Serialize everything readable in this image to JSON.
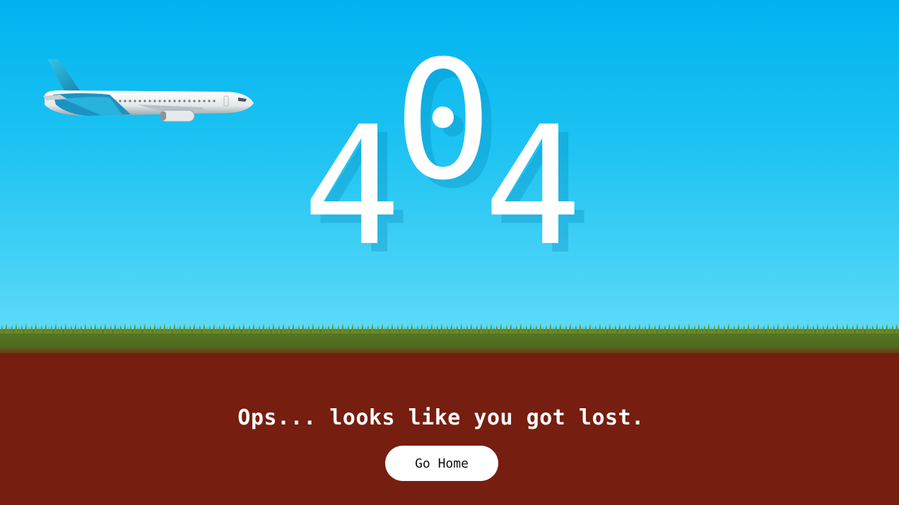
{
  "error": {
    "digits": [
      "4",
      "0",
      "4"
    ]
  },
  "message": "Ops... looks like you got lost.",
  "home_button": {
    "label": "Go Home"
  },
  "colors": {
    "sky_top": "#00b3f0",
    "sky_bottom": "#5ddaf8",
    "grass": "#4e6b1e",
    "ground": "#761e10",
    "text": "#ffffff",
    "button_bg": "#ffffff"
  },
  "icons": {
    "plane": "airplane-icon"
  }
}
